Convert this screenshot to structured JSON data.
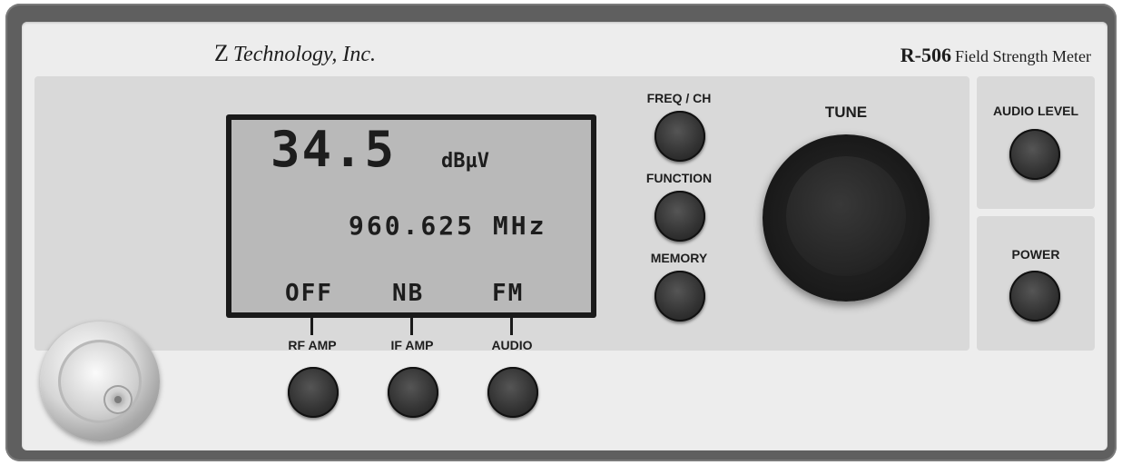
{
  "header": {
    "brand_logo_letter": "Z",
    "brand_name": "Technology, Inc.",
    "model_number": "R-506",
    "model_description": "Field Strength Meter"
  },
  "display": {
    "level_value": "34.5",
    "level_unit": "dBµV",
    "frequency": "960.625 MHz",
    "softkeys": [
      "OFF",
      "NB",
      "FM"
    ]
  },
  "buttons": {
    "rf_amp": "RF AMP",
    "if_amp": "IF AMP",
    "audio": "AUDIO",
    "freq_ch": "FREQ / CH",
    "function": "FUNCTION",
    "memory": "MEMORY",
    "tune": "TUNE",
    "audio_level": "AUDIO LEVEL",
    "power": "POWER"
  },
  "colors": {
    "faceplate": "#ededed",
    "panel": "#d9d9d9",
    "lcd": "#b9b9b9",
    "button": "#333333"
  },
  "icons": [
    "rf-connector-icon",
    "tune-knob-icon"
  ]
}
